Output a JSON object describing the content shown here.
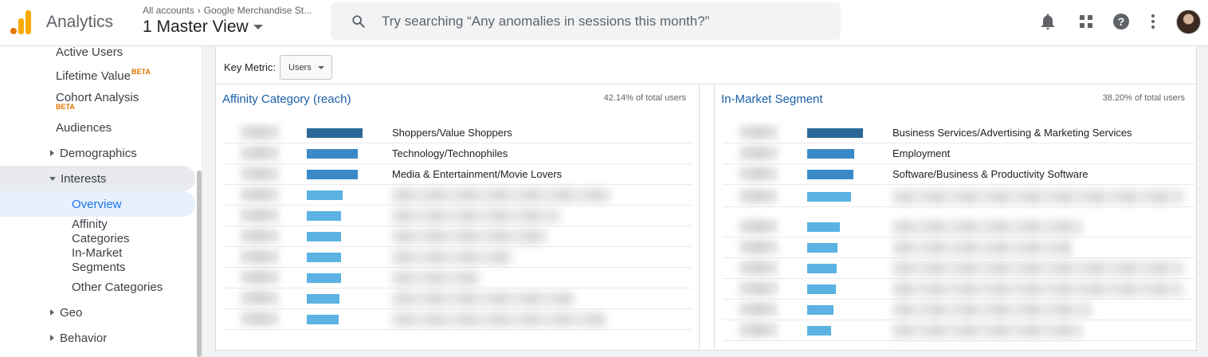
{
  "header": {
    "app_name": "Analytics",
    "breadcrumb": [
      "All accounts",
      "Google Merchandise St..."
    ],
    "view_name": "1 Master View",
    "search_placeholder": "Try searching “Any anomalies in sessions this month?”",
    "icons": [
      "notifications-icon",
      "apps-grid-icon",
      "help-icon",
      "more-vert-icon",
      "account-avatar"
    ]
  },
  "sidebar": {
    "items": [
      {
        "label": "Active Users"
      },
      {
        "label": "Lifetime Value",
        "badge": "BETA"
      },
      {
        "label": "Cohort Analysis",
        "badge": "BETA"
      },
      {
        "label": "Audiences"
      },
      {
        "label": "Demographics"
      },
      {
        "label": "Interests"
      },
      {
        "label": "Overview",
        "selected": true
      },
      {
        "label": "Affinity Categories"
      },
      {
        "label": "In-Market Segments"
      },
      {
        "label": "Other Categories"
      },
      {
        "label": "Geo"
      },
      {
        "label": "Behavior"
      }
    ]
  },
  "controls": {
    "key_metric_label": "Key Metric:",
    "key_metric_value": "Users"
  },
  "affinity": {
    "title": "Affinity Category (reach)",
    "share": "42.14% of total users",
    "rows": [
      {
        "label": "Shoppers/Value Shoppers",
        "bar_fraction": 1.0
      },
      {
        "label": "Technology/Technophiles",
        "bar_fraction": 0.91
      },
      {
        "label": "Media & Entertainment/Movie Lovers",
        "bar_fraction": 0.91
      },
      {
        "label": "",
        "bar_fraction": 0.64
      },
      {
        "label": "",
        "bar_fraction": 0.61
      },
      {
        "label": "",
        "bar_fraction": 0.61
      },
      {
        "label": "",
        "bar_fraction": 0.61
      },
      {
        "label": "",
        "bar_fraction": 0.61
      },
      {
        "label": "",
        "bar_fraction": 0.59
      },
      {
        "label": "",
        "bar_fraction": 0.57
      }
    ]
  },
  "inmarket": {
    "title": "In-Market Segment",
    "share": "38.20% of total users",
    "rows": [
      {
        "label": "Business Services/Advertising & Marketing Services",
        "bar_fraction": 1.0
      },
      {
        "label": "Employment",
        "bar_fraction": 0.84
      },
      {
        "label": "Software/Business & Productivity Software",
        "bar_fraction": 0.83
      },
      {
        "label": "",
        "bar_fraction": 0.79
      },
      {
        "label": "",
        "bar_fraction": 0.59
      },
      {
        "label": "",
        "bar_fraction": 0.54
      },
      {
        "label": "",
        "bar_fraction": 0.53
      },
      {
        "label": "",
        "bar_fraction": 0.51
      },
      {
        "label": "",
        "bar_fraction": 0.47
      },
      {
        "label": "",
        "bar_fraction": 0.43
      }
    ]
  },
  "colors": {
    "bar_dark": "#2a6796",
    "bar_mid": "#3a8ac7",
    "bar_light": "#5bb2e3",
    "title_blue": "#1a5fa8",
    "selected_bg": "#e8f0fe",
    "selected_text": "#1a73e8"
  }
}
